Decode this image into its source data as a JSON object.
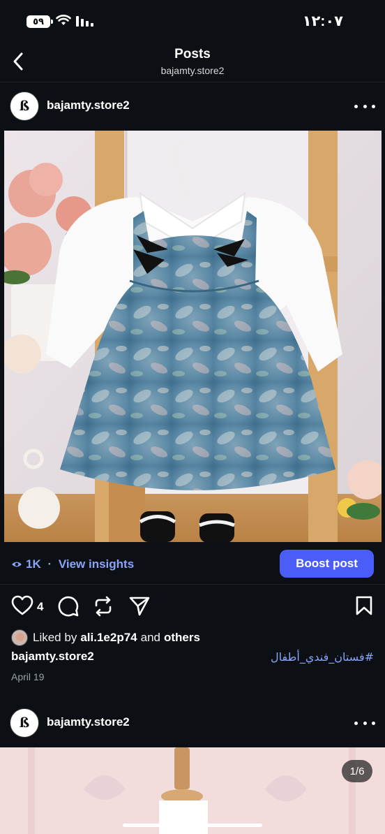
{
  "status_bar": {
    "battery": "٥٩",
    "time": "١٢:٠٧"
  },
  "header": {
    "title": "Posts",
    "subtitle": "bajamty.store2"
  },
  "posts": [
    {
      "username": "bajamty.store2",
      "insights": {
        "views": "1K",
        "separator": " · ",
        "label": "View insights"
      },
      "boost_label": "Boost post",
      "likes": "4",
      "liked_by": {
        "prefix": "Liked by",
        "user": "ali.1e2p74",
        "middle": "and",
        "suffix": "others"
      },
      "caption_user": "bajamty.store2",
      "caption_tag": "#فستان_فندي_أطفال",
      "date": "April 19"
    },
    {
      "username": "bajamty.store2",
      "image_counter": "1/6"
    }
  ],
  "colors": {
    "background": "#0c1014",
    "accent_link": "#8aa4f8",
    "boost_button": "#4a5df9"
  },
  "icons": [
    "back-icon",
    "eye-icon",
    "heart-icon",
    "comment-icon",
    "repost-icon",
    "send-icon",
    "bookmark-icon",
    "more-icon",
    "wifi-icon",
    "signal-icon"
  ]
}
